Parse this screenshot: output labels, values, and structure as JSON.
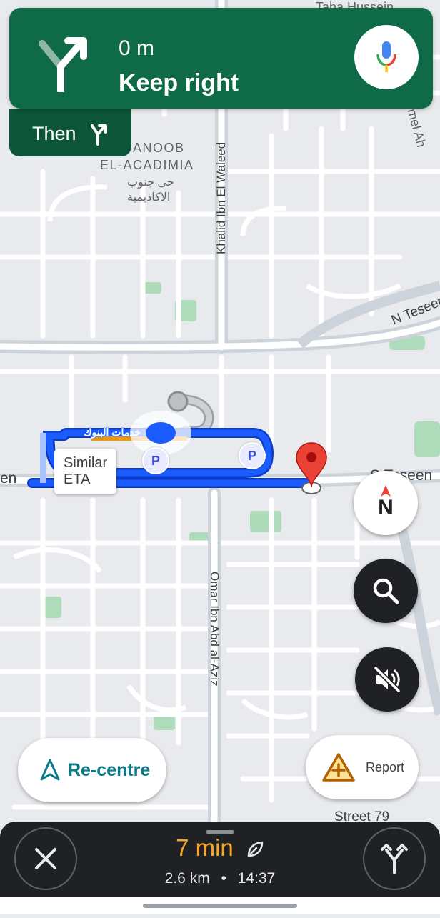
{
  "navigation": {
    "distance": "0 m",
    "instruction": "Keep right",
    "then_label": "Then"
  },
  "map_labels": {
    "district_line1": "ANOOB",
    "district_line2": "EL-ACADIMIA",
    "district_arabic_line1": "حى جنوب",
    "district_arabic_line2": "الاكاديمية",
    "street_khalid": "Khalid Ibn El Waleed",
    "street_omar": "Omar Ibn Abd al-Aziz",
    "street_teseen_upper": "N Teseen",
    "street_teseen_lower": "S Teseen",
    "street_79": "Street 79",
    "top_label_1": "Taha Hussein",
    "place_label": "خدمات البنوك",
    "edge_label_left": "en",
    "edge_label_right": "mel Ah"
  },
  "route_chip": {
    "line1": "Similar",
    "line2": "ETA"
  },
  "compass": {
    "label": "N"
  },
  "buttons": {
    "recentre_label": "Re-centre",
    "report_label": "Report"
  },
  "trip": {
    "eta_minutes": "7 min",
    "distance": "2.6 km",
    "separator": "•",
    "arrival_time": "14:37"
  },
  "colors": {
    "nav_green": "#0f6b47",
    "nav_green_dark": "#0c5538",
    "route_blue": "#1a5cff",
    "eta_orange": "#f5a623",
    "bottom_bar": "#202124",
    "pin_red": "#ea4335"
  },
  "icons": {
    "maneuver": "keep-right-arrow-icon",
    "then": "fork-right-icon",
    "mic": "google-mic-icon",
    "search": "search-icon",
    "mute": "volume-muted-icon",
    "recentre": "navigation-arrow-icon",
    "report": "warning-plus-icon",
    "close": "close-icon",
    "alternate_routes": "route-fork-icon",
    "eco": "leaf-icon"
  }
}
